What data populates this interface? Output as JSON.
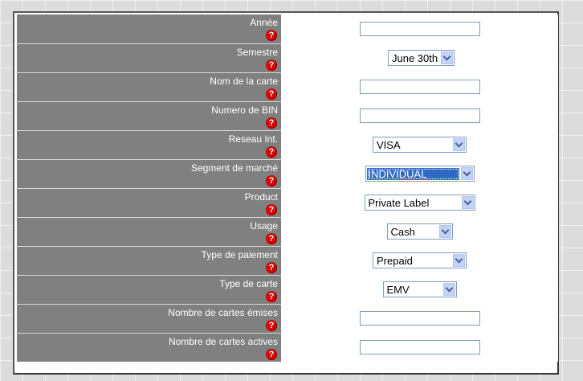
{
  "form": {
    "rows": [
      {
        "label": "Année",
        "help": "?",
        "type": "text",
        "value": ""
      },
      {
        "label": "Semestre",
        "help": "?",
        "type": "select",
        "value": "June 30th"
      },
      {
        "label": "Nom de la carte",
        "help": "?",
        "type": "text",
        "value": ""
      },
      {
        "label": "Numero de BIN",
        "help": "?",
        "type": "text",
        "value": ""
      },
      {
        "label": "Reseau Int.",
        "help": "?",
        "type": "select",
        "value": "VISA"
      },
      {
        "label": "Segment de marché",
        "help": "?",
        "type": "select",
        "value": "INDIVIDUAL",
        "focused": true
      },
      {
        "label": "Product",
        "help": "?",
        "type": "select",
        "value": "Private Label"
      },
      {
        "label": "Usage",
        "help": "?",
        "type": "select",
        "value": "Cash"
      },
      {
        "label": "Type de paiement",
        "help": "?",
        "type": "select",
        "value": "Prepaid"
      },
      {
        "label": "Type de carte",
        "help": "?",
        "type": "select",
        "value": "EMV"
      },
      {
        "label": "Nombre de cartes émises",
        "help": "?",
        "type": "text",
        "value": ""
      },
      {
        "label": "Nombre de cartes actives",
        "help": "?",
        "type": "text",
        "value": ""
      }
    ]
  },
  "icons": {
    "help": "help-icon",
    "dropdown": "chevron-down-icon"
  },
  "colors": {
    "label_bg": "#808080",
    "help_icon": "#d80000",
    "selection": "#316ac5",
    "input_border": "#7f9db9"
  }
}
